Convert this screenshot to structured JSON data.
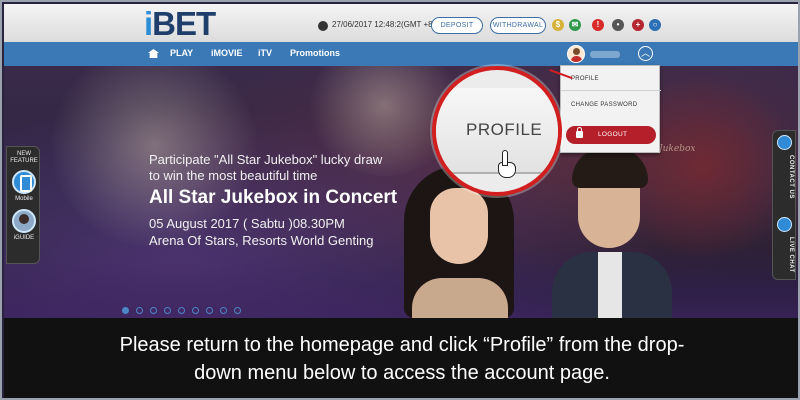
{
  "header": {
    "logo_i": "i",
    "logo_rest": "BET",
    "datetime": "27/06/2017 12:48:2(GMT +8)",
    "deposit_label": "DEPOSIT",
    "withdrawal_label": "WITHDRAWAL"
  },
  "nav": {
    "items": [
      "PLAY",
      "iMOVIE",
      "iTV",
      "Promotions"
    ]
  },
  "banner": {
    "line1": "Participate \"All Star Jukebox\" lucky draw",
    "line2": "to win the most beautiful time",
    "title": "All Star Jukebox in Concert",
    "date": "05 August 2017 ( Sabtu )08.30PM",
    "venue": "Arena Of Stars, Resorts World Genting",
    "carousel": {
      "count": 9,
      "active_index": 0
    }
  },
  "side_left": {
    "new": "NEW",
    "feature": "FEATURE",
    "mobile": "Mobile",
    "iguide": "iGUIDE"
  },
  "side_right": {
    "contact": "CONTACT US",
    "livechat": "LIVE CHAT"
  },
  "dropdown": {
    "profile": "PROFILE",
    "change_password": "CHANGE PASSWORD",
    "logout": "LOGOUT"
  },
  "magnifier": {
    "label": "PROFILE"
  },
  "caption": {
    "line1": "Please return to the homepage and click “Profile” from the drop-",
    "line2": "down menu below to access the account page."
  },
  "colors": {
    "brand_blue": "#3a79b5",
    "logout_red": "#b51f2a",
    "callout_red": "#d11f1f"
  }
}
